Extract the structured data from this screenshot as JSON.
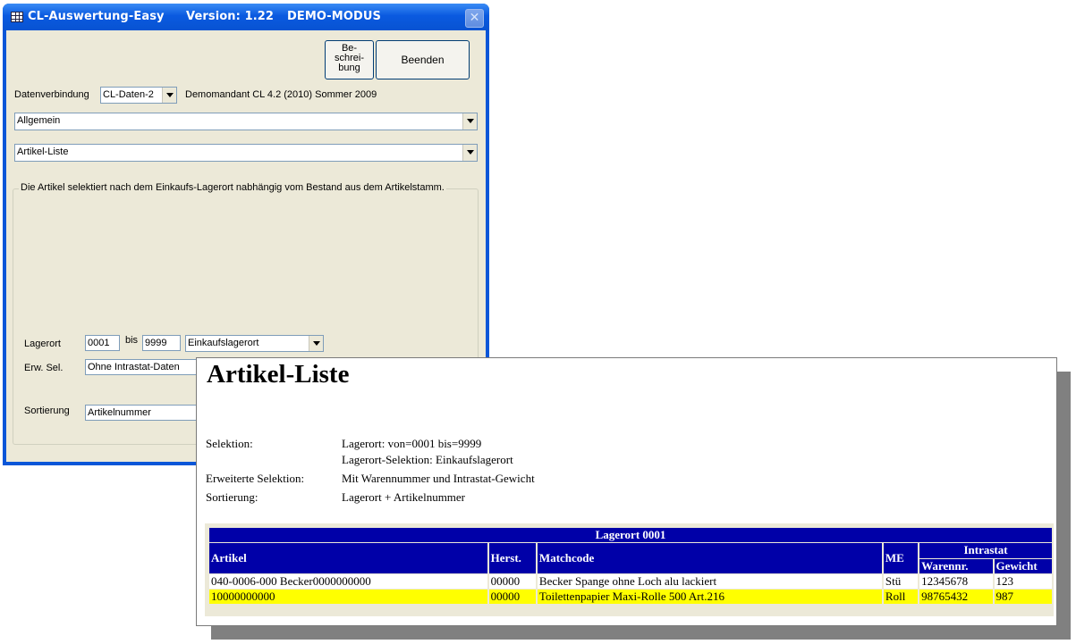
{
  "window": {
    "title": "CL-Auswertung-Easy",
    "version": "Version: 1.22",
    "mode": "DEMO-MODUS",
    "close_symbol": "✕"
  },
  "buttons": {
    "beschreibung_lines": [
      "Be-",
      "schrei-",
      "bung"
    ],
    "beenden": "Beenden"
  },
  "connection": {
    "label": "Datenverbindung",
    "value": "CL-Daten-2",
    "info": "Demomandant CL 4.2 (2010) Sommer 2009"
  },
  "category_select": "Allgemein",
  "report_select": "Artikel-Liste",
  "description": "Die Artikel selektiert nach dem Einkaufs-Lagerort nabhängig vom Bestand aus dem Artikelstamm.",
  "filters": {
    "lagerort_label": "Lagerort",
    "lagerort_from": "0001",
    "bis_label": "bis",
    "lagerort_to": "9999",
    "lagerort_type": "Einkaufslagerort",
    "erw_label": "Erw. Sel.",
    "erw_value": "Ohne Intrastat-Daten",
    "sort_label": "Sortierung",
    "sort_value": "Artikelnummer"
  },
  "report": {
    "title": "Artikel-Liste",
    "selektion_label": "Selektion:",
    "selektion_line1": "Lagerort: von=0001 bis=9999",
    "selektion_line2": "Lagerort-Selektion: Einkaufslagerort",
    "erw_label": "Erweiterte Selektion:",
    "erw_value": "Mit Warennummer und Intrastat-Gewicht",
    "sort_label": "Sortierung:",
    "sort_value": "Lagerort + Artikelnummer",
    "table": {
      "group_header": "Lagerort 0001",
      "headers": {
        "artikel": "Artikel",
        "herst": "Herst.",
        "matchcode": "Matchcode",
        "me": "ME",
        "intrastat": "Intrastat",
        "warennr": "Warennr.",
        "gewicht": "Gewicht"
      },
      "rows": [
        {
          "artikel": "040-0006-000 Becker0000000000",
          "herst": "00000",
          "matchcode": "Becker Spange ohne Loch alu lackiert",
          "me": "Stü",
          "warennr": "12345678",
          "gewicht": "123"
        },
        {
          "artikel": "10000000000",
          "herst": "00000",
          "matchcode": "Toilettenpapier Maxi-Rolle 500 Art.216",
          "me": "Roll",
          "warennr": "98765432",
          "gewicht": "987"
        }
      ]
    }
  },
  "colors": {
    "title_bar": "#0a5ae0",
    "dialog_bg": "#ece9d8",
    "table_header": "#0000a8",
    "highlight_row": "#ffff00"
  }
}
